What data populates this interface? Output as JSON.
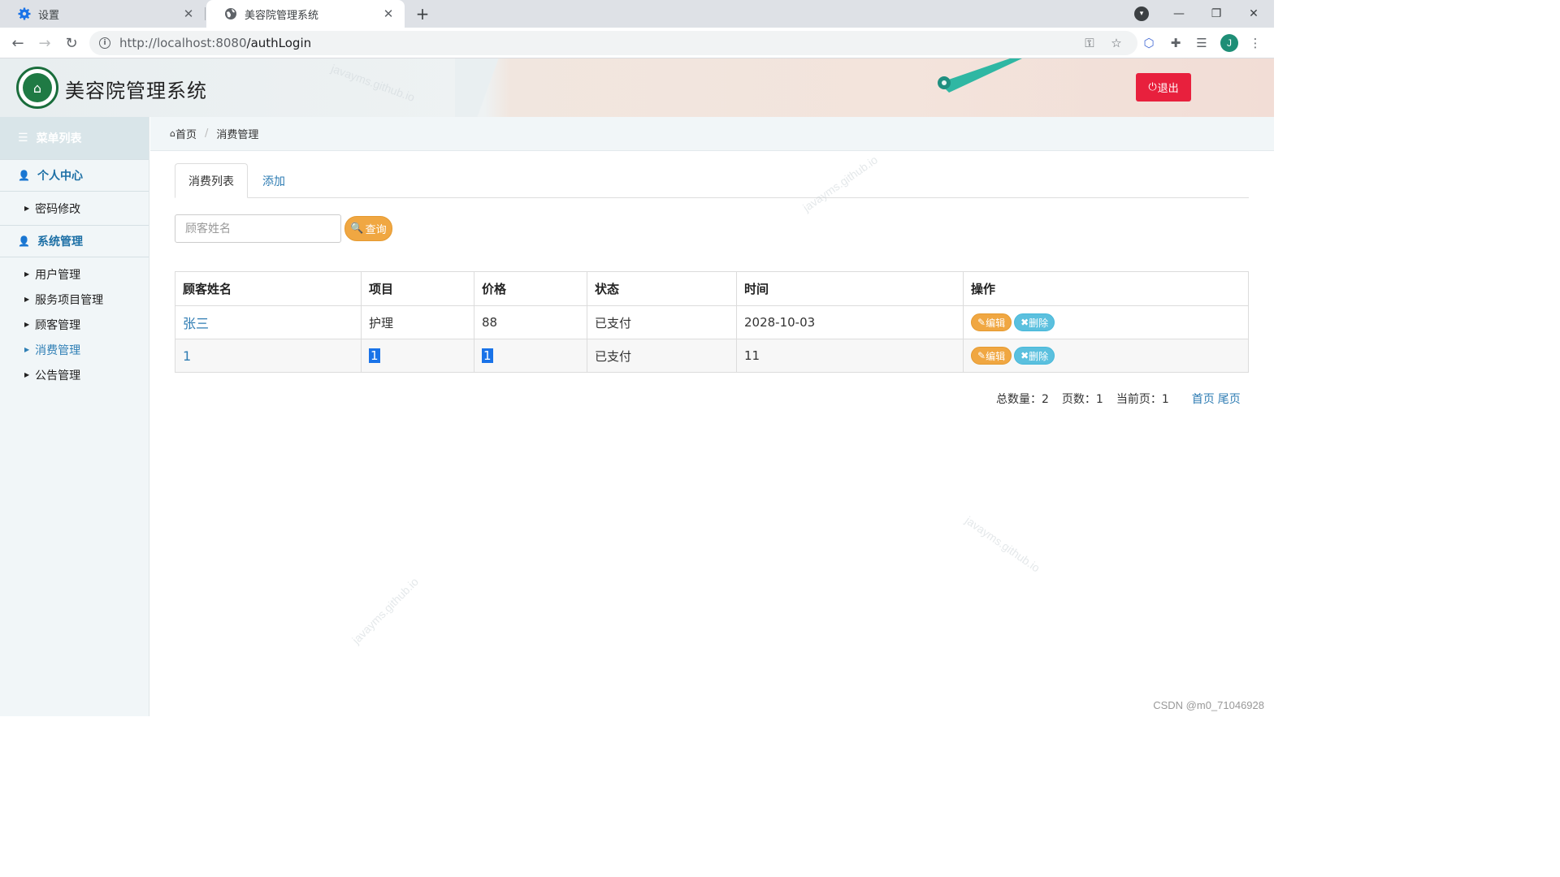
{
  "browser": {
    "tabs": [
      {
        "title": "设置",
        "icon": "gear-icon"
      },
      {
        "title": "美容院管理系统",
        "icon": "globe-icon"
      }
    ],
    "url_host": "http://localhost:8080",
    "url_path": "/authLogin",
    "avatar_letter": "J"
  },
  "header": {
    "title": "美容院管理系统",
    "logout_label": "退出"
  },
  "sidebar": {
    "menu_title": "菜单列表",
    "groups": [
      {
        "label": "个人中心",
        "items": [
          {
            "label": "密码修改"
          }
        ]
      },
      {
        "label": "系统管理",
        "items": [
          {
            "label": "用户管理"
          },
          {
            "label": "服务项目管理"
          },
          {
            "label": "顾客管理"
          },
          {
            "label": "消费管理"
          },
          {
            "label": "公告管理"
          }
        ]
      }
    ]
  },
  "breadcrumb": {
    "home": "首页",
    "current": "消费管理"
  },
  "tabs": {
    "list": "消费列表",
    "add": "添加"
  },
  "search": {
    "placeholder": "顾客姓名",
    "button": "查询"
  },
  "table": {
    "headers": [
      "顾客姓名",
      "项目",
      "价格",
      "状态",
      "时间",
      "操作"
    ],
    "rows": [
      {
        "name": "张三",
        "project": "护理",
        "price": "88",
        "status": "已支付",
        "time": "2028-10-03"
      },
      {
        "name": "1",
        "project": "1",
        "price": "1",
        "status": "已支付",
        "time": "11"
      }
    ],
    "edit_label": "编辑",
    "delete_label": "删除"
  },
  "pager": {
    "total_label": "总数量：2",
    "pages_label": "页数：1",
    "current_label": "当前页：1",
    "first": "首页",
    "last": "尾页"
  },
  "watermark_text": "javayms.github.io",
  "footer_credit": "CSDN @m0_71046928",
  "colors": {
    "accent": "#2e7cb3",
    "logout": "#e8203d",
    "search_button": "#f0a742",
    "delete_button": "#5bc0de"
  }
}
